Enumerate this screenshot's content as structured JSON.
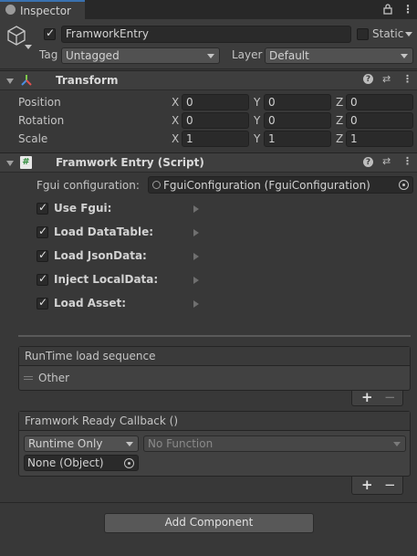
{
  "window": {
    "tab_label": "Inspector"
  },
  "object": {
    "name": "FramworkEntry",
    "active": true,
    "static_label": "Static",
    "static_checked": false,
    "tag_label": "Tag",
    "tag_value": "Untagged",
    "layer_label": "Layer",
    "layer_value": "Default"
  },
  "transform": {
    "title": "Transform",
    "rows": [
      {
        "label": "Position",
        "x": "0",
        "y": "0",
        "z": "0"
      },
      {
        "label": "Rotation",
        "x": "0",
        "y": "0",
        "z": "0"
      },
      {
        "label": "Scale",
        "x": "1",
        "y": "1",
        "z": "1"
      }
    ],
    "axis": {
      "x": "X",
      "y": "Y",
      "z": "Z"
    }
  },
  "script": {
    "title": "Framwork Entry (Script)",
    "config_label": "Fgui configuration:",
    "config_value": "FguiConfiguration (FguiConfiguration)",
    "toggles": [
      {
        "label": "Use Fgui:",
        "checked": true
      },
      {
        "label": "Load DataTable:",
        "checked": true
      },
      {
        "label": "Load JsonData:",
        "checked": true
      },
      {
        "label": "Inject LocalData:",
        "checked": true
      },
      {
        "label": "Load Asset:",
        "checked": true
      }
    ],
    "sequence": {
      "title": "RunTime load sequence",
      "items": [
        "Other"
      ],
      "add_label": "+",
      "remove_label": "−"
    },
    "callback": {
      "title": "Framwork Ready Callback ()",
      "mode": "Runtime Only",
      "function": "No Function",
      "target": "None (Object)",
      "add_label": "+",
      "remove_label": "−"
    }
  },
  "add_component_label": "Add Component",
  "icons": {
    "inspector": "info-icon",
    "lock": "lock-icon",
    "menu": "kebab-menu-icon",
    "help": "help-icon",
    "preset": "preset-icon",
    "gameobject": "cube-icon"
  }
}
